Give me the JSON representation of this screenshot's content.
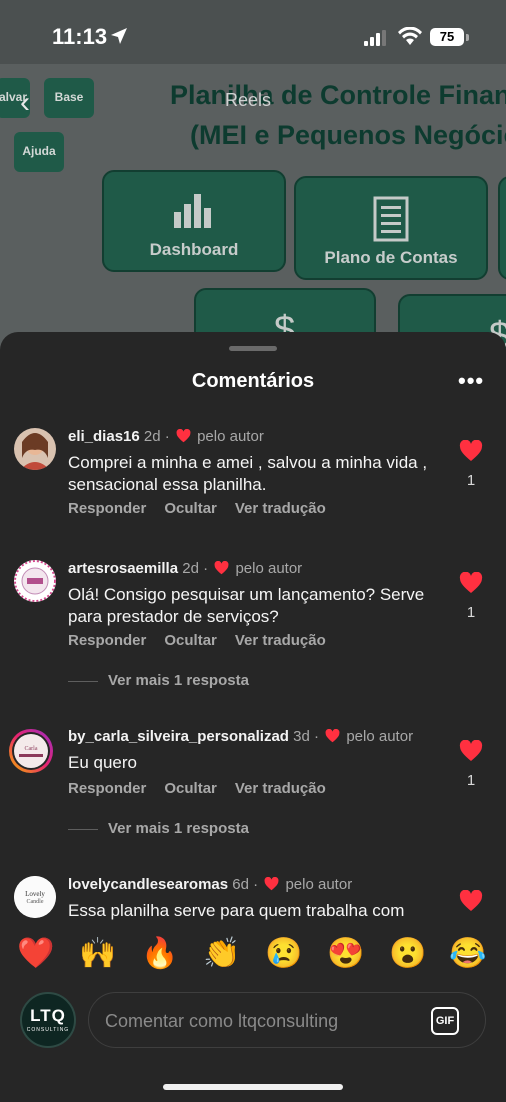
{
  "status_bar": {
    "time": "11:13",
    "battery": "75"
  },
  "background": {
    "reels_label": "Reels",
    "title_line1": "Planilha de Controle Financeiro",
    "title_line2": "(MEI e Pequenos Negócios)",
    "buttons": [
      "alvar",
      "Base",
      "Ajuda"
    ],
    "tiles": [
      "Dashboard",
      "Plano de Contas"
    ]
  },
  "sheet": {
    "title": "Comentários",
    "comments": [
      {
        "user": "eli_dias16",
        "age": "2d",
        "badge": "pelo autor",
        "text": "Comprei a minha e amei , salvou a minha vida , sensacional essa planilha.",
        "reply": "Responder",
        "hide": "Ocultar",
        "translate": "Ver tradução",
        "likes": "1"
      },
      {
        "user": "artesrosaemilla",
        "age": "2d",
        "badge": "pelo autor",
        "text": "Olá! Consigo pesquisar um lançamento? Serve para prestador de serviços?",
        "reply": "Responder",
        "hide": "Ocultar",
        "translate": "Ver tradução",
        "likes": "1",
        "more_replies": "Ver mais 1 resposta"
      },
      {
        "user": "by_carla_silveira_personalizad",
        "age": "3d",
        "badge": "pelo autor",
        "text": "Eu quero",
        "reply": "Responder",
        "hide": "Ocultar",
        "translate": "Ver tradução",
        "likes": "1",
        "more_replies": "Ver mais 1 resposta"
      },
      {
        "user": "lovelycandlesearomas",
        "age": "6d",
        "badge": "pelo autor",
        "text": "Essa planilha serve para quem trabalha com"
      }
    ]
  },
  "emoji_bar": [
    "❤️",
    "🙌",
    "🔥",
    "👏",
    "😢",
    "😍",
    "😮",
    "😂"
  ],
  "composer": {
    "avatar_text": "LTQ",
    "avatar_sub": "CONSULTING",
    "placeholder": "Comentar como ltqconsulting",
    "gif_label": "GIF"
  },
  "colors": {
    "sheet_bg": "#262626",
    "heart": "#ff3040"
  }
}
